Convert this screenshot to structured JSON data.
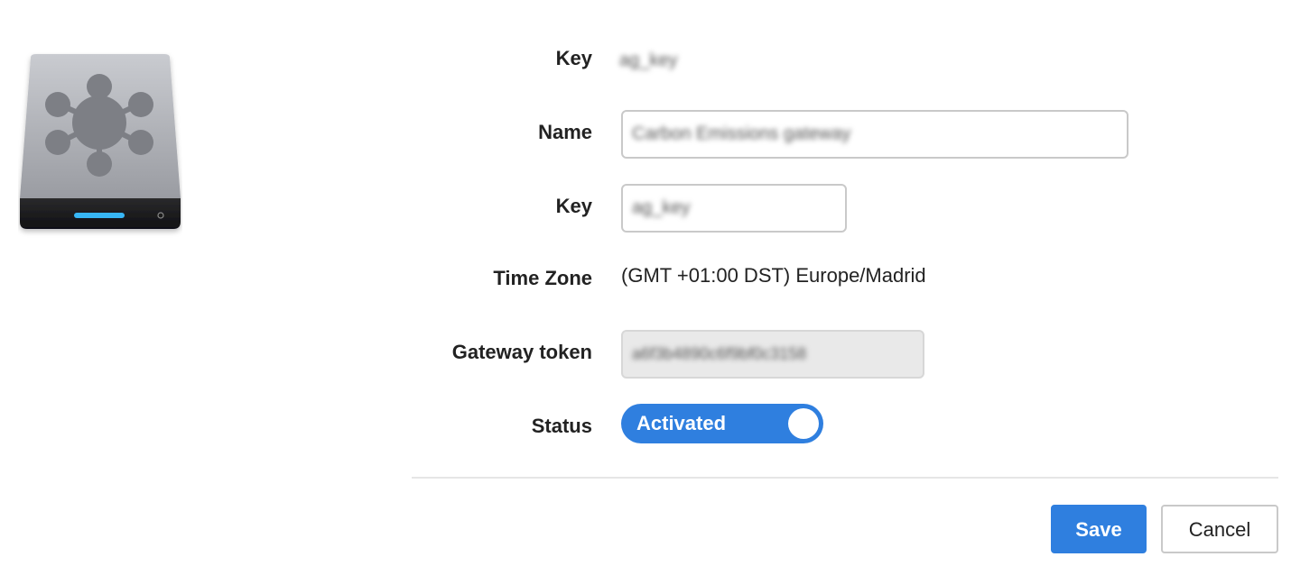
{
  "device": {
    "icon": "gateway-hub-icon",
    "status_light_color": "#37b6f6"
  },
  "form": {
    "key_display": {
      "label": "Key",
      "value": "ag_key"
    },
    "name": {
      "label": "Name",
      "value": "Carbon Emissions gateway"
    },
    "key_input": {
      "label": "Key",
      "value": "ag_key"
    },
    "time_zone": {
      "label": "Time Zone",
      "value": "(GMT +01:00 DST) Europe/Madrid"
    },
    "gateway_token": {
      "label": "Gateway token",
      "value": "a6f3b4890c6f9bf0c3158"
    },
    "status": {
      "label": "Status",
      "toggle_label": "Activated",
      "on": true,
      "color": "#2f7fdf"
    }
  },
  "actions": {
    "save_label": "Save",
    "cancel_label": "Cancel"
  },
  "colors": {
    "accent": "#2f7fdf"
  }
}
